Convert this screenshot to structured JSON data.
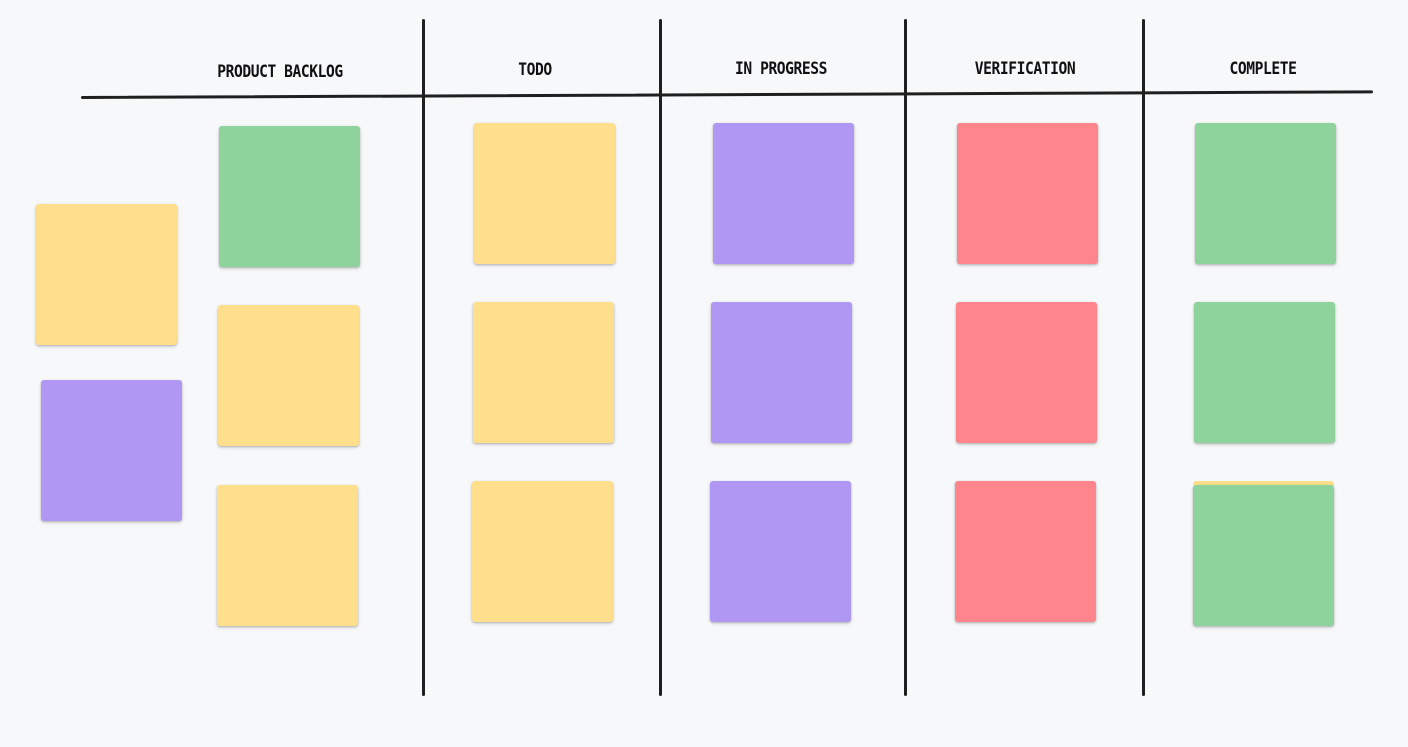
{
  "board": {
    "columns": [
      {
        "id": "backlog",
        "title": "PRODUCT BACKLOG"
      },
      {
        "id": "todo",
        "title": "TODO"
      },
      {
        "id": "in_progress",
        "title": "IN PROGRESS"
      },
      {
        "id": "verification",
        "title": "VERIFICATION"
      },
      {
        "id": "complete",
        "title": "COMPLETE"
      }
    ],
    "note_colors": {
      "yellow": "#ffdf8c",
      "green": "#8dd39b",
      "purple": "#b097f3",
      "red": "#ff858d"
    },
    "notes": {
      "backlog": [
        "green",
        "yellow",
        "yellow"
      ],
      "backlog_loose": [
        "yellow",
        "purple"
      ],
      "todo": [
        "yellow",
        "yellow",
        "yellow"
      ],
      "in_progress": [
        "purple",
        "purple",
        "purple"
      ],
      "verification": [
        "red",
        "red",
        "red"
      ],
      "complete": [
        "green",
        "green",
        "green"
      ],
      "complete_stacked_under_last": [
        "yellow"
      ]
    }
  }
}
